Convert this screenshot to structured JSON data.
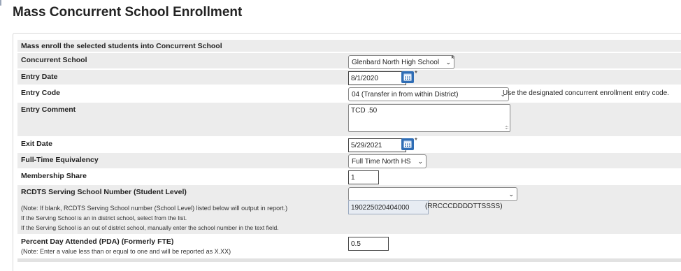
{
  "page": {
    "title": "Mass Concurrent School Enrollment"
  },
  "section": {
    "header": "Mass enroll the selected students into Concurrent School"
  },
  "fields": {
    "concurrent_school": {
      "label": "Concurrent School",
      "value": "Glenbard North High School",
      "required_mark": "*"
    },
    "entry_date": {
      "label": "Entry Date",
      "value": "8/1/2020",
      "required_mark": "*"
    },
    "entry_code": {
      "label": "Entry Code",
      "value": "04 (Transfer in from within District)",
      "hint": "Use the designated concurrent enrollment entry code."
    },
    "entry_comment": {
      "label": "Entry Comment",
      "value": "TCD .50"
    },
    "exit_date": {
      "label": "Exit Date",
      "value": "5/29/2021",
      "required_mark": "*"
    },
    "fte": {
      "label": "Full-Time Equivalency",
      "value": "Full Time North HS"
    },
    "membership_share": {
      "label": "Membership Share",
      "value": "1"
    },
    "rcdts": {
      "label": "RCDTS Serving School Number (Student Level)",
      "value": "",
      "note1": "(Note: If blank, RCDTS Serving School number (School Level) listed below will output in report.)",
      "note2": "If the Serving School is an in district school, select from the list.",
      "note3": "If the Serving School is an out of district school, manually enter the school number in the text field.",
      "number_value": "190225020404000",
      "format_hint": "(RRCCCDDDDTTSSSS)"
    },
    "pda": {
      "label": "Percent Day Attended (PDA) (Formerly FTE)",
      "note": "(Note: Enter a value less than or equal to one and will be reported as X.XX)",
      "value": "0.5"
    }
  },
  "icons": {
    "calendar": "calendar-icon",
    "dropdown": "chevron-down-icon"
  },
  "colors": {
    "row_shade": "#ececec",
    "calendar_button": "#2f6db5"
  }
}
